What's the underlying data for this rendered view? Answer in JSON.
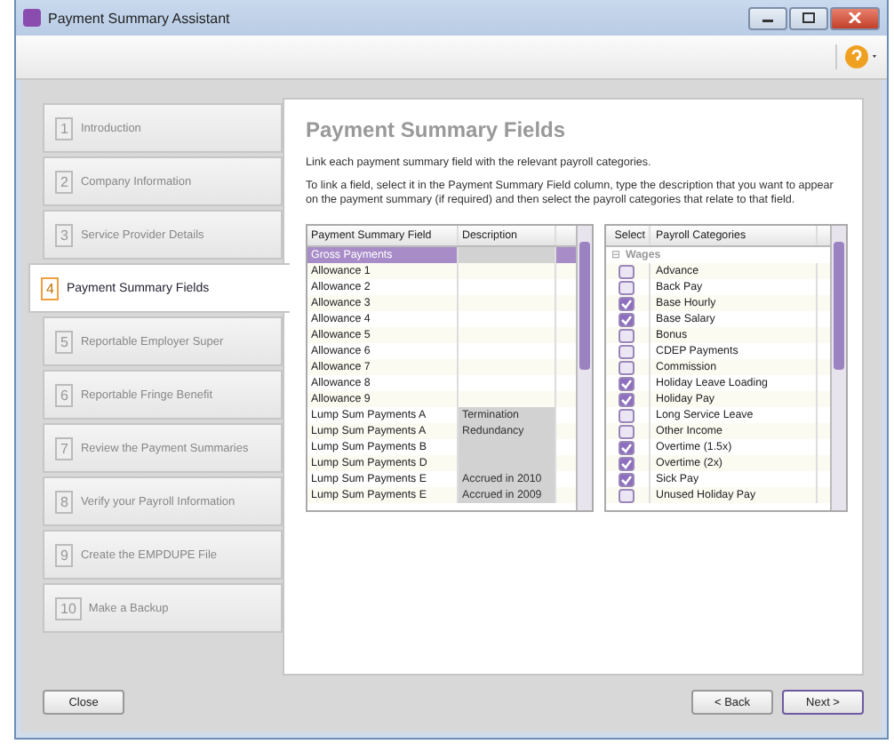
{
  "window": {
    "title": "Payment Summary Assistant"
  },
  "steps": [
    {
      "number": "1",
      "label": "Introduction",
      "selected": false
    },
    {
      "number": "2",
      "label": "Company Information",
      "selected": false
    },
    {
      "number": "3",
      "label": "Service Provider Details",
      "selected": false
    },
    {
      "number": "4",
      "label": "Payment Summary Fields",
      "selected": true
    },
    {
      "number": "5",
      "label": "Reportable Employer Super",
      "selected": false
    },
    {
      "number": "6",
      "label": "Reportable Fringe Benefit",
      "selected": false
    },
    {
      "number": "7",
      "label": "Review the Payment Summaries",
      "selected": false
    },
    {
      "number": "8",
      "label": "Verify your Payroll Information",
      "selected": false
    },
    {
      "number": "9",
      "label": "Create the EMPDUPE File",
      "selected": false
    },
    {
      "number": "10",
      "label": "Make a Backup",
      "selected": false
    }
  ],
  "page": {
    "heading": "Payment Summary Fields",
    "intro": "Link each payment summary field with the relevant payroll categories.",
    "instructions": "To link a field, select it in the Payment Summary Field column,  type the description that you want to appear on the payment summary (if required) and then select the payroll categories that relate to that field."
  },
  "fields_table": {
    "columns": [
      "Payment Summary Field",
      "Description"
    ],
    "rows": [
      {
        "field": "Gross Payments",
        "description": "",
        "shaded": true,
        "selected": true
      },
      {
        "field": "Allowance 1",
        "description": "",
        "shaded": false,
        "selected": false
      },
      {
        "field": "Allowance 2",
        "description": "",
        "shaded": false,
        "selected": false
      },
      {
        "field": "Allowance 3",
        "description": "",
        "shaded": false,
        "selected": false
      },
      {
        "field": "Allowance 4",
        "description": "",
        "shaded": false,
        "selected": false
      },
      {
        "field": "Allowance 5",
        "description": "",
        "shaded": false,
        "selected": false
      },
      {
        "field": "Allowance 6",
        "description": "",
        "shaded": false,
        "selected": false
      },
      {
        "field": "Allowance 7",
        "description": "",
        "shaded": false,
        "selected": false
      },
      {
        "field": "Allowance 8",
        "description": "",
        "shaded": false,
        "selected": false
      },
      {
        "field": "Allowance 9",
        "description": "",
        "shaded": false,
        "selected": false
      },
      {
        "field": "Lump Sum Payments A",
        "description": "Termination",
        "shaded": true,
        "selected": false
      },
      {
        "field": "Lump Sum Payments A",
        "description": "Redundancy",
        "shaded": true,
        "selected": false
      },
      {
        "field": "Lump Sum Payments B",
        "description": "",
        "shaded": true,
        "selected": false
      },
      {
        "field": "Lump Sum Payments D",
        "description": "",
        "shaded": true,
        "selected": false
      },
      {
        "field": "Lump Sum Payments E",
        "description": "Accrued in 2010",
        "shaded": true,
        "selected": false
      },
      {
        "field": "Lump Sum Payments E",
        "description": "Accrued in 2009",
        "shaded": true,
        "selected": false
      }
    ]
  },
  "categories_table": {
    "columns": [
      "Select",
      "Payroll Categories"
    ],
    "group": {
      "name": "Wages",
      "expanded": true,
      "toggle": "⊟"
    },
    "rows": [
      {
        "name": "Advance",
        "checked": false
      },
      {
        "name": "Back Pay",
        "checked": false
      },
      {
        "name": "Base Hourly",
        "checked": true
      },
      {
        "name": "Base Salary",
        "checked": true
      },
      {
        "name": "Bonus",
        "checked": false
      },
      {
        "name": "CDEP Payments",
        "checked": false
      },
      {
        "name": "Commission",
        "checked": false
      },
      {
        "name": "Holiday Leave Loading",
        "checked": true
      },
      {
        "name": "Holiday Pay",
        "checked": true
      },
      {
        "name": "Long Service Leave",
        "checked": false
      },
      {
        "name": "Other Income",
        "checked": false
      },
      {
        "name": "Overtime (1.5x)",
        "checked": true
      },
      {
        "name": "Overtime (2x)",
        "checked": true
      },
      {
        "name": "Sick Pay",
        "checked": true
      },
      {
        "name": "Unused Holiday Pay",
        "checked": false
      }
    ]
  },
  "buttons": {
    "close": "Close",
    "back": "< Back",
    "next": "Next >"
  }
}
